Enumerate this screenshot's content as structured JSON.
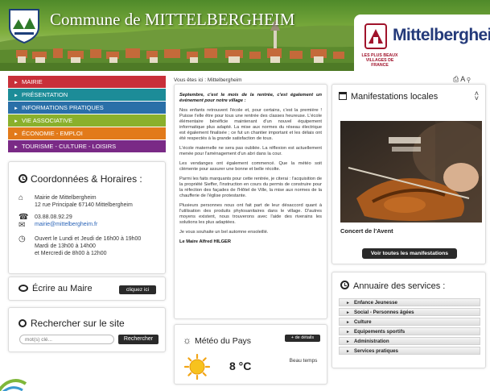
{
  "header": {
    "site_title": "Commune de MITTELBERGHEIM",
    "label_title": "Mittelbergheim",
    "label_subtitle": "LES PLUS BEAUX VILLAGES DE FRANCE"
  },
  "nav": [
    {
      "label": "MAIRIE",
      "color": "#c8303a"
    },
    {
      "label": "PRÉSENTATION",
      "color": "#1c8c98"
    },
    {
      "label": "INFORMATIONS PRATIQUES",
      "color": "#2a6fa8"
    },
    {
      "label": "VIE ASSOCIATIVE",
      "color": "#8ab02c"
    },
    {
      "label": "ÉCONOMIE - EMPLOI",
      "color": "#e27a1a"
    },
    {
      "label": "TOURISME - CULTURE - LOISIRS",
      "color": "#7a2a86"
    }
  ],
  "coordonnees": {
    "title": "Coordonnées & Horaires :",
    "address_line1": "Mairie de Mittelbergheim",
    "address_line2": "12 rue Principale 67140 Mittelbergheim",
    "phone": "03.88.08.92.29",
    "email": "mairie@mittelbergheim.fr",
    "hours_line1": "Ouvert le Lundi et Jeudi de 16h00 à 19h00",
    "hours_line2": "Mardi de 13h00 à 14h00",
    "hours_line3": "et Mercredi de 8h00 à 12h00"
  },
  "ecrire": {
    "title": "Écrire au Maire",
    "button": "cliquez ici"
  },
  "recherche": {
    "title": "Rechercher sur le site",
    "placeholder": "mot(s) clé...",
    "button": "Rechercher"
  },
  "breadcrumb": "Vous êtes ici : Mittelbergheim",
  "toolbar_icons": [
    "print-icon",
    "font-size-icon",
    "zoom-icon"
  ],
  "article": {
    "lead": "Septembre, c'est le mois de la rentrée, c'est également un événement pour notre village :",
    "p1": "Nos enfants retrouvent l'école et, pour certains, c'est la première ! Puisse t'elle être pour tous une rentrée des classes heureuse. L'école élémentaire bénéficie maintenant d'un nouvel équipement informatique plus adapté. La mise aux normes du réseau électrique est également finalisée ; ce fut un chantier important et les délais ont été respectés à la grande satisfaction de tous.",
    "p2": "L'école maternelle ne sera pas oubliée. La réflexion est actuellement menée pour l'aménagement d'un abri dans la cour.",
    "p3": "Les vendanges ont également commencé. Que la météo soit clémente pour assurer une bonne et belle récolte.",
    "p4": "Parmi les faits marquants pour cette rentrée, je citerai : l'acquisition de la propriété Sieffer, l'instruction en cours du permis de construire pour la réfection des façades de l'Hôtel de Ville, la mise aux normes de la chaufferie de l'église protestante.",
    "p5": "Plusieurs personnes nous ont fait part de leur désaccord quant à l'utilisation des produits phytosanitaires dans le village. D'autres moyens existent, nous trouverons avec l'aide des riverains les solutions les plus adaptées.",
    "p6": "Je vous souhaite un bel automne ensoleillé.",
    "signature": "Le Maire Alfred HILGER"
  },
  "meteo": {
    "title": "Météo du Pays",
    "button": "+ de détails",
    "temperature": "8 °C",
    "condition": "Beau temps"
  },
  "manifestations": {
    "title": "Manifestations locales",
    "event_title": "Concert de l'Avent",
    "button": "Voir toutes les manifestations"
  },
  "annuaire": {
    "title": "Annuaire des services :",
    "items": [
      "Enfance Jeunesse",
      "Social - Personnes âgées",
      "Culture",
      "Equipements sportifs",
      "Administration",
      "Services pratiques"
    ]
  }
}
